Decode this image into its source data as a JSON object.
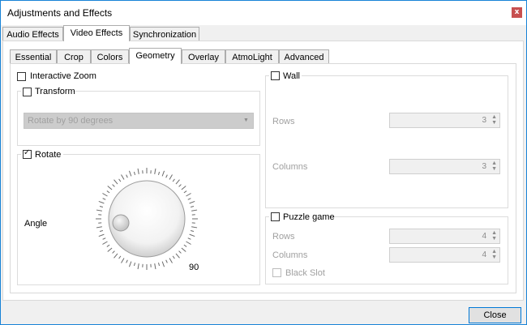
{
  "window": {
    "title": "Adjustments and Effects",
    "close_glyph": "x"
  },
  "main_tabs": [
    {
      "label": "Audio Effects"
    },
    {
      "label": "Video Effects"
    },
    {
      "label": "Synchronization"
    }
  ],
  "sub_tabs": [
    {
      "label": "Essential"
    },
    {
      "label": "Crop"
    },
    {
      "label": "Colors"
    },
    {
      "label": "Geometry"
    },
    {
      "label": "Overlay"
    },
    {
      "label": "AtmoLight"
    },
    {
      "label": "Advanced"
    }
  ],
  "active_main_tab": "Video Effects",
  "active_sub_tab": "Geometry",
  "geometry": {
    "interactive_zoom": {
      "label": "Interactive Zoom",
      "checked": false
    },
    "transform": {
      "label": "Transform",
      "checked": false,
      "select_value": "Rotate by 90 degrees"
    },
    "rotate": {
      "label": "Rotate",
      "checked": true,
      "angle_label": "Angle",
      "angle_value": "90"
    },
    "wall": {
      "label": "Wall",
      "checked": false,
      "rows_label": "Rows",
      "rows_value": "3",
      "columns_label": "Columns",
      "columns_value": "3"
    },
    "puzzle": {
      "label": "Puzzle game",
      "checked": false,
      "rows_label": "Rows",
      "rows_value": "4",
      "columns_label": "Columns",
      "columns_value": "4",
      "black_slot_label": "Black Slot",
      "black_slot_checked": false
    }
  },
  "footer": {
    "close_label": "Close"
  },
  "icons": {
    "checkmark": "✓",
    "dropdown_arrow": "▼",
    "spin_up": "▲",
    "spin_down": "▼"
  },
  "colors": {
    "accent": "#0078d7",
    "window_border": "#1883d7",
    "close_red": "#c75050"
  }
}
